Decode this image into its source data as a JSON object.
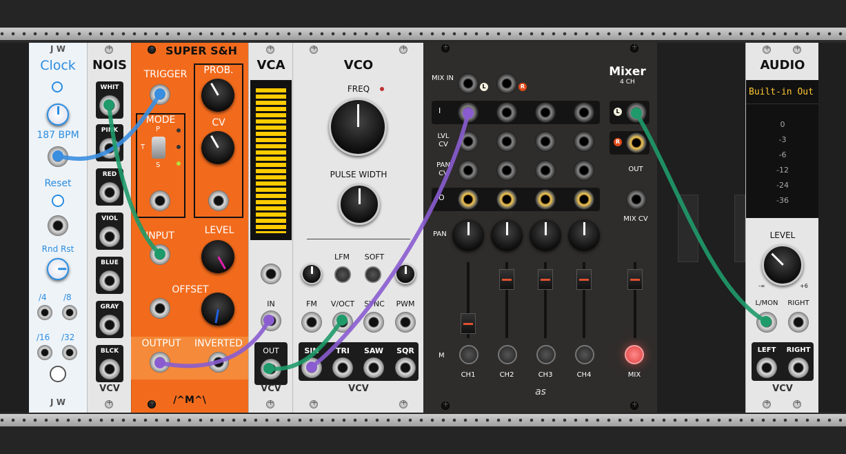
{
  "clock": {
    "brand": "J W",
    "title": "Clock",
    "bpm": "187 BPM",
    "reset": "Reset",
    "rnd_rst": "Rnd Rst",
    "div4": "/4",
    "div8": "/8",
    "div16": "/16",
    "div32": "/32"
  },
  "noise": {
    "title": "NOIS",
    "ports": [
      "WHIT",
      "PINK",
      "RED",
      "VIOL",
      "BLUE",
      "GRAY",
      "BLCK"
    ],
    "brand": "VCV"
  },
  "sh": {
    "title": "SUPER S&H",
    "trigger": "TRIGGER",
    "prob": "PROB.",
    "mode": "MODE",
    "mode_p": "P",
    "mode_t": "T",
    "mode_s": "S",
    "cv": "CV",
    "input": "INPUT",
    "level": "LEVEL",
    "offset": "OFFSET",
    "output": "OUTPUT",
    "inverted": "INVERTED",
    "brand": "/^M^\\"
  },
  "vca": {
    "title": "VCA",
    "in": "IN",
    "out": "OUT",
    "brand": "VCV"
  },
  "vco": {
    "title": "VCO",
    "freq": "FREQ",
    "pulse_width": "PULSE WIDTH",
    "lfm": "LFM",
    "soft": "SOFT",
    "fm": "FM",
    "voct": "V/OCT",
    "sync": "SYNC",
    "pwm": "PWM",
    "sin": "SIN",
    "tri": "TRI",
    "saw": "SAW",
    "sqr": "SQR",
    "brand": "VCV"
  },
  "mixer": {
    "title": "Mixer",
    "subtitle": "4 CH",
    "mix_in": "MIX IN",
    "l": "L",
    "r": "R",
    "i": "I",
    "lvl_cv": "LVL CV",
    "pan_cv": "PAN CV",
    "o": "O",
    "pan": "PAN",
    "out": "OUT",
    "mix_cv": "MIX CV",
    "m": "M",
    "channels": [
      "CH1",
      "CH2",
      "CH3",
      "CH4"
    ],
    "mix": "MIX",
    "brand": "as"
  },
  "audio": {
    "title": "AUDIO",
    "device": "Built-in Out",
    "db_levels": [
      "0",
      "-3",
      "-6",
      "-12",
      "-24",
      "-36"
    ],
    "level": "LEVEL",
    "min": "-∞",
    "max": "+6",
    "lmon": "L/MON",
    "right": "RIGHT",
    "left": "LEFT",
    "right2": "RIGHT",
    "brand": "VCV"
  },
  "colors": {
    "cable_blue": "#3a8ee0",
    "cable_green": "#1f9a6a",
    "cable_purple": "#8a5cd0",
    "sh_orange": "#f26b1d",
    "clock_blue": "#2a8ce0"
  }
}
